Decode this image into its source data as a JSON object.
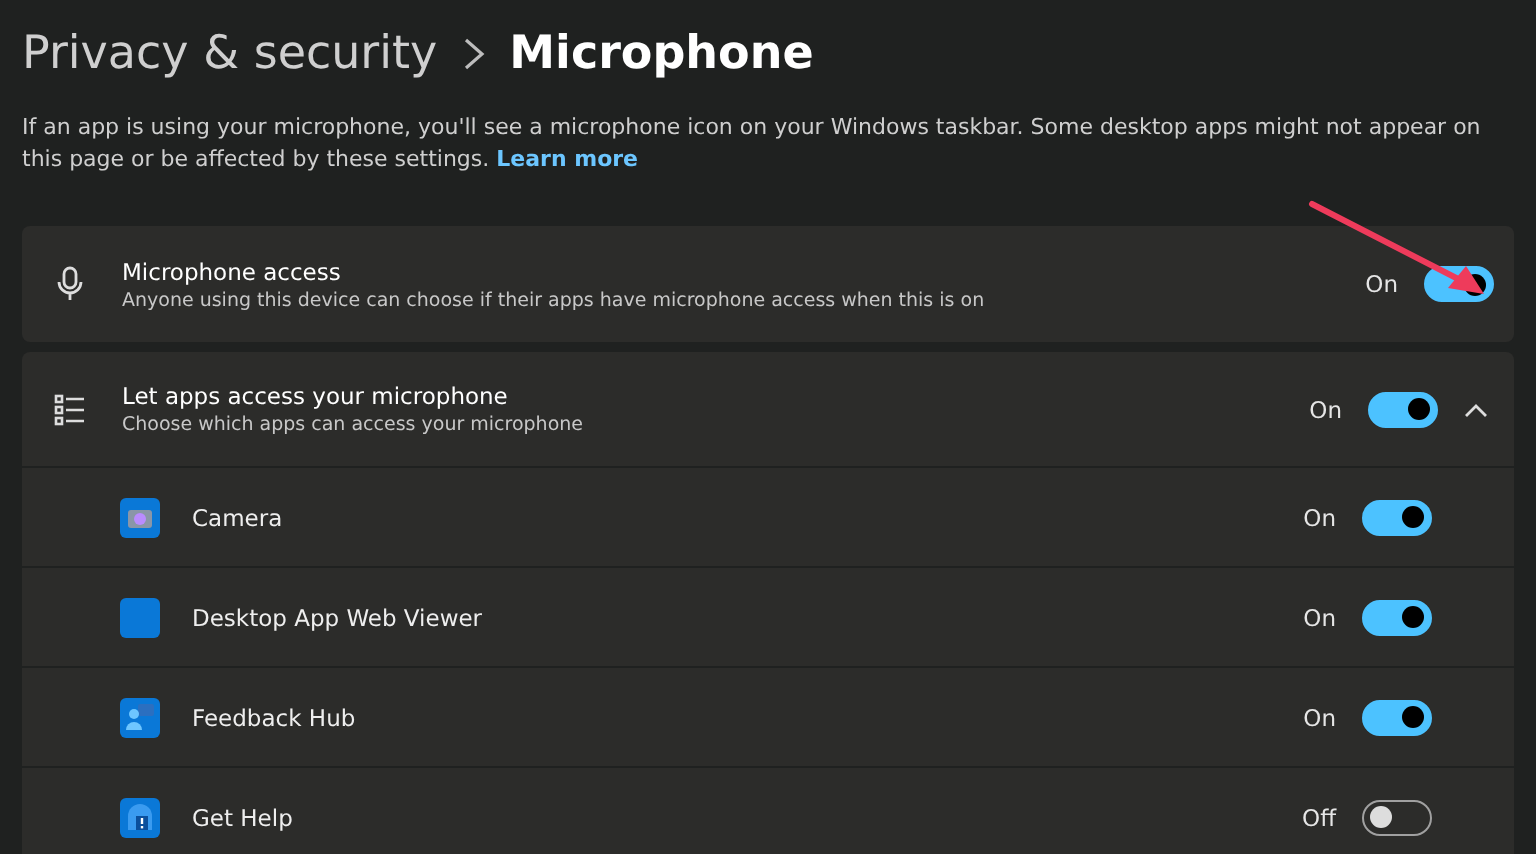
{
  "breadcrumb": {
    "parent": "Privacy & security",
    "current": "Microphone"
  },
  "description": {
    "text": "If an app is using your microphone, you'll see a microphone icon on your Windows taskbar. Some desktop apps might not appear on this page or be affected by these settings.",
    "link": "Learn more"
  },
  "microphone_access": {
    "title": "Microphone access",
    "subtitle": "Anyone using this device can choose if their apps have microphone access when this is on",
    "state_label": "On",
    "on": true
  },
  "app_access": {
    "title": "Let apps access your microphone",
    "subtitle": "Choose which apps can access your microphone",
    "state_label": "On",
    "on": true,
    "expanded": true,
    "apps": [
      {
        "name": "Camera",
        "kind": "camera",
        "state_label": "On",
        "on": true
      },
      {
        "name": "Desktop App Web Viewer",
        "kind": "plain",
        "state_label": "On",
        "on": true
      },
      {
        "name": "Feedback Hub",
        "kind": "feedback",
        "state_label": "On",
        "on": true
      },
      {
        "name": "Get Help",
        "kind": "help",
        "state_label": "Off",
        "on": false
      }
    ]
  }
}
